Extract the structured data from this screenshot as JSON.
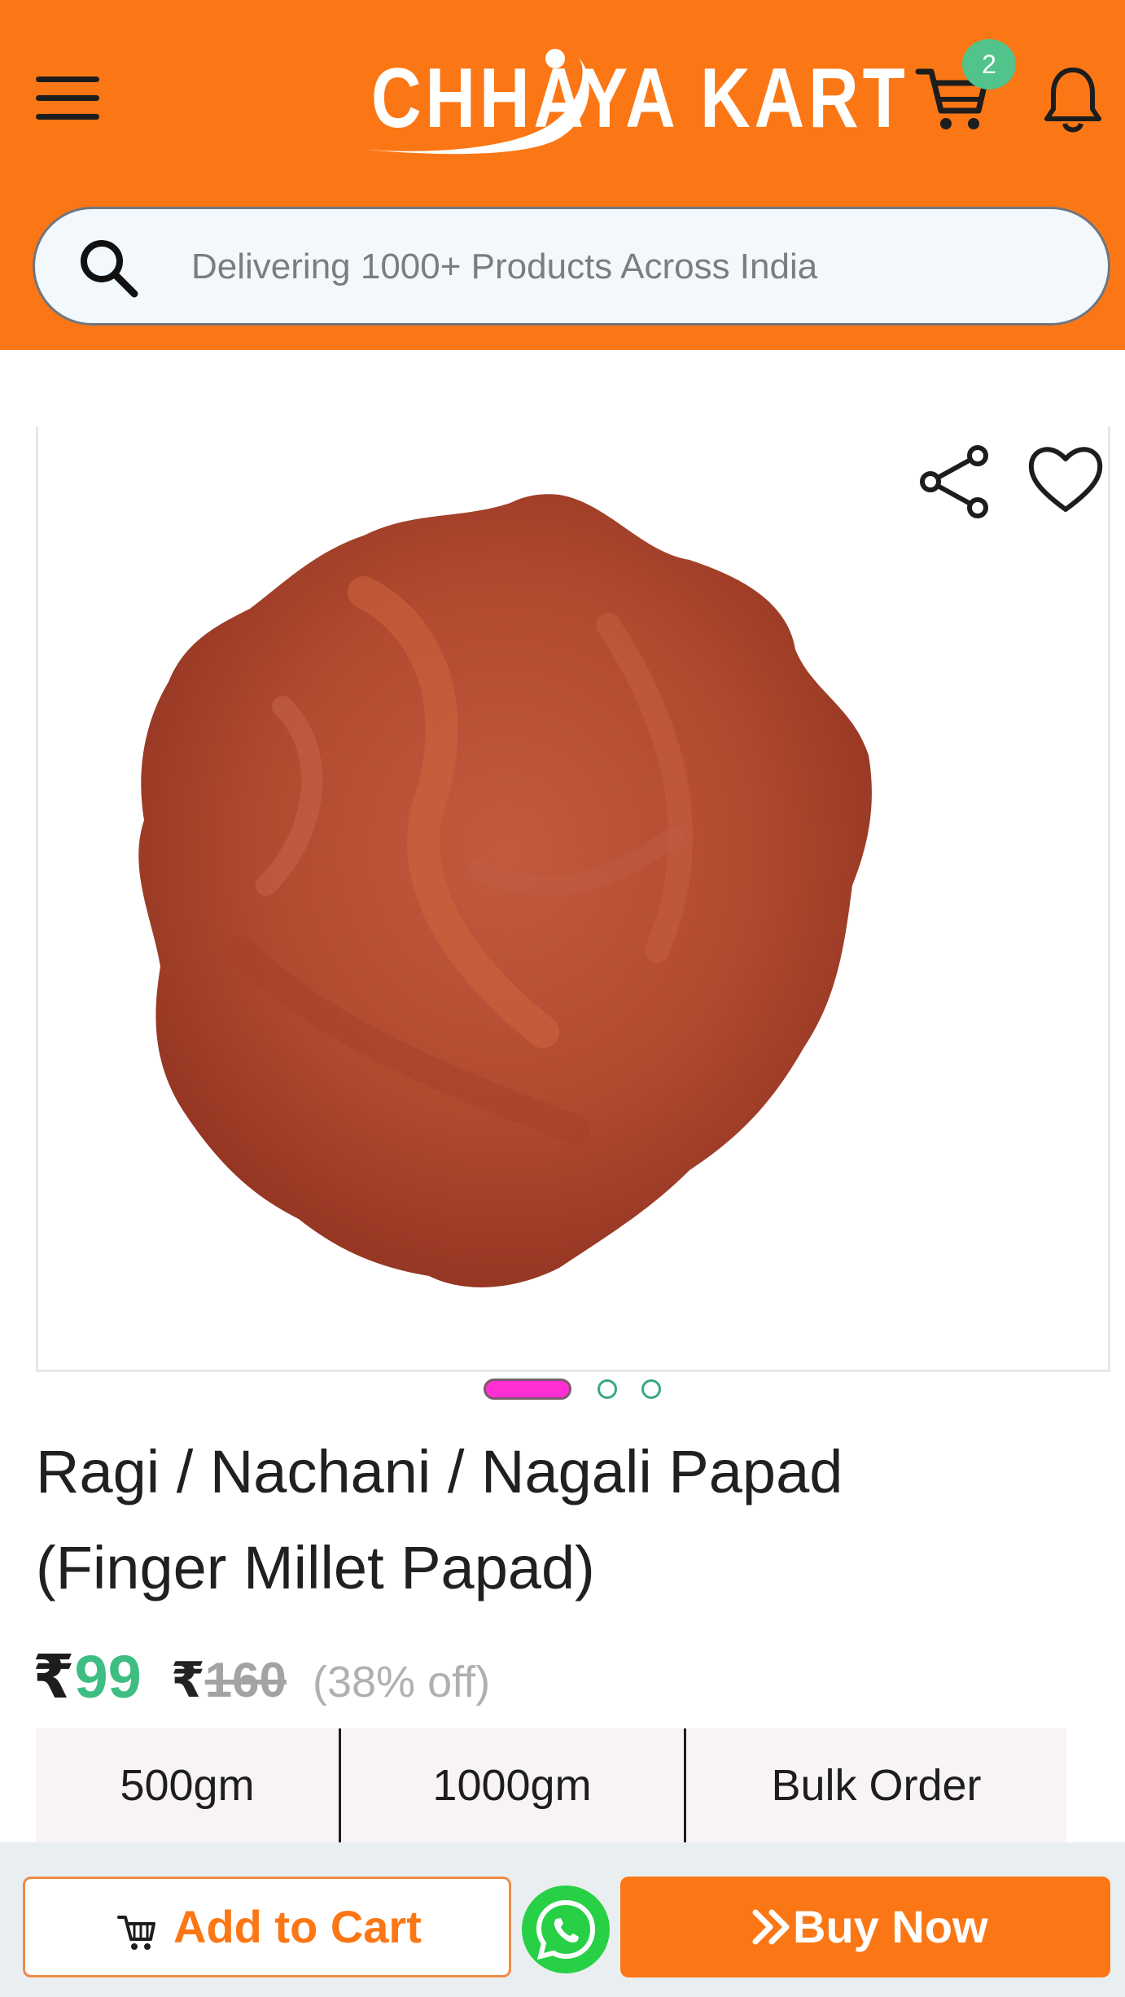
{
  "header": {
    "brand": "CHHAYA KART",
    "menu_icon": "hamburger-menu-icon",
    "cart_icon": "cart-icon",
    "cart_count": "2",
    "bell_icon": "bell-icon",
    "background_color": "#fb7715"
  },
  "search": {
    "placeholder": "Delivering 1000+ Products Across India",
    "value": ""
  },
  "gallery": {
    "image_alt": "Ragi papad",
    "total_images": 3,
    "active_index": 0,
    "share_icon": "share-icon",
    "wishlist_icon": "heart-icon"
  },
  "product": {
    "title_line1": "Ragi / Nachani / Nagali Papad",
    "title_line2": "(Finger Millet Papad)",
    "currency": "₹",
    "price": "99",
    "mrp": "160",
    "discount": "(38% off)",
    "price_color": "#3ebd83"
  },
  "variants": [
    {
      "label": "500gm"
    },
    {
      "label": "1000gm"
    },
    {
      "label": "Bulk Order"
    }
  ],
  "actions": {
    "add_to_cart": "Add to Cart",
    "buy_now": "Buy Now",
    "whatsapp_icon": "whatsapp-icon",
    "accent_color": "#fb7715",
    "whatsapp_color": "#27d045"
  }
}
